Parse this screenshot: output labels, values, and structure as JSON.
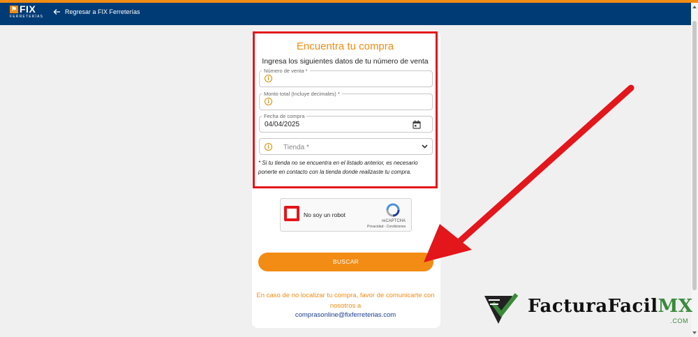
{
  "header": {
    "logo_text": "FIX",
    "logo_subtext": "FERRETERÍAS",
    "back_label": "Regresar a FIX Ferreterías"
  },
  "form": {
    "title": "Encuentra tu compra",
    "subtitle": "Ingresa los siguientes datos de tu número de venta",
    "sale_number": {
      "label": "Número de venta *",
      "value": ""
    },
    "total_amount": {
      "label": "Monto total (Incluye decimales) *",
      "value": ""
    },
    "purchase_date": {
      "label": "Fecha de compra",
      "value": "04/04/2025"
    },
    "store": {
      "placeholder": "Tienda *"
    },
    "note": "* Si tu tienda no se encuentra en el listado anterior, es necesario ponerte en contacto con la tienda donde realizaste tu compra."
  },
  "recaptcha": {
    "label": "No soy un robot",
    "brand": "reCAPTCHA",
    "links": "Privacidad - Condiciones"
  },
  "search_button": "BUSCAR",
  "contact": {
    "text": "En caso de no localizar tu compra, favor de comunicarte con nosotros a",
    "email": "comprasonline@fixferreterias.com"
  },
  "watermark": {
    "name": "FacturaFacil",
    "suffix": "MX",
    "domain": ".COM"
  },
  "colors": {
    "accent": "#f28c14",
    "header": "#003b75",
    "highlight": "#e3161b"
  }
}
